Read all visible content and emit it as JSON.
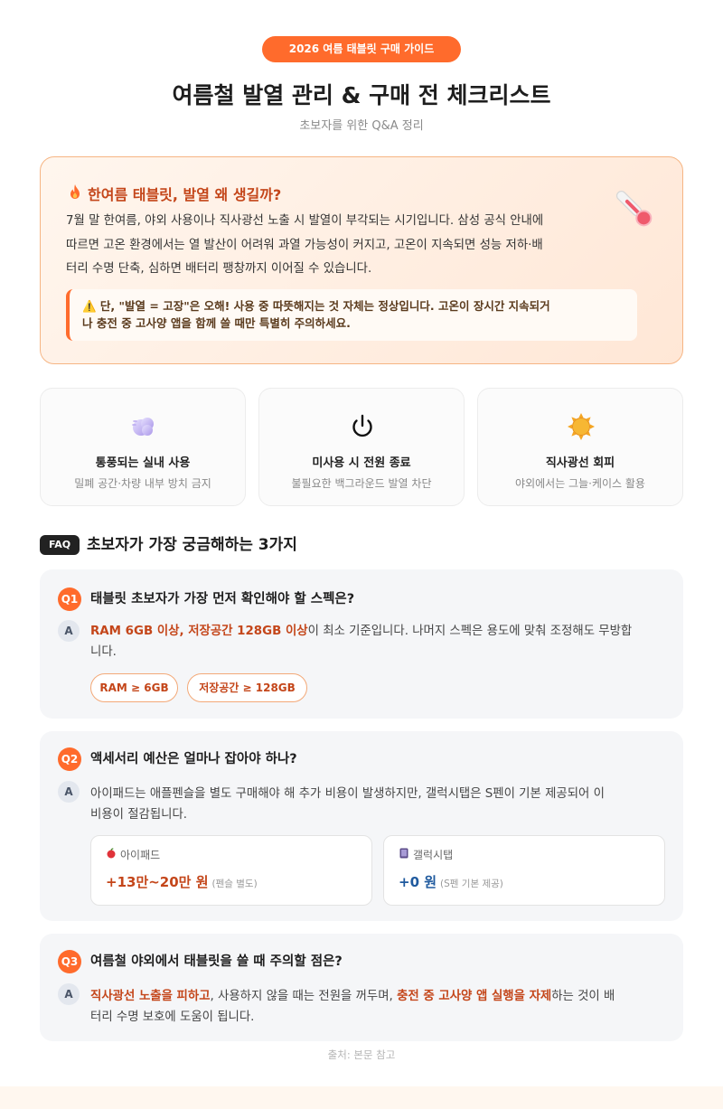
{
  "header": {
    "pill": "2026 여름 태블릿 구매 가이드",
    "title": "여름철 발열 관리 & 구매 전 체크리스트",
    "subtitle": "초보자를 위한 Q&A 정리"
  },
  "hero": {
    "title": "한여름 태블릿, 발열 왜 생길까?",
    "icon": "flame-icon",
    "lines": [
      "7월 말 한여름, 야외 사용이나 직사광선 노출 시 발열이 부각되는 시기입니다. 삼성 공식 안내에",
      "따르면 고온 환경에서는 열 발산이 어려워 과열 가능성이 커지고, 고온이 지속되면 성능 저하·배",
      "터리 수명 단축, 심하면 배터리 팽창까지 이어질 수 있습니다."
    ],
    "note_lines": [
      "⚠️ 단, \"발열 = 고장\"은 오해! 사용 중 따뜻해지는 것 자체는 정상입니다. 고온이 장시간 지속되거",
      "나 충전 중 고사양 앱을 함께 쓸 때만 특별히 주의하세요."
    ]
  },
  "tips": [
    {
      "icon": "wind-cloud-icon",
      "title": "통풍되는 실내 사용",
      "desc": "밀폐 공간·차량 내부 방치 금지"
    },
    {
      "icon": "power-icon",
      "title": "미사용 시 전원 종료",
      "desc": "불필요한 백그라운드 발열 차단"
    },
    {
      "icon": "sun-icon",
      "title": "직사광선 회피",
      "desc": "야외에서는 그늘·케이스 활용"
    }
  ],
  "faq": {
    "tag": "FAQ",
    "title": "초보자가 가장 궁금해하는 3가지",
    "items": [
      {
        "badge": "Q1",
        "question": "태블릿 초보자가 가장 먼저 확인해야 할 스펙은?",
        "a_badge": "A",
        "answer_hl": "RAM 6GB 이상, 저장공간 128GB 이상",
        "answer_rest_1": "이 최소 기준입니다. 나머지 스펙은 용도에 맞춰 조정해도 무방합",
        "answer_rest_2": "니다.",
        "chips": [
          "RAM ≥ 6GB",
          "저장공간 ≥ 128GB"
        ]
      },
      {
        "badge": "Q2",
        "question": "액세서리 예산은 얼마나 잡아야 하나?",
        "a_badge": "A",
        "answer_line_1": "아이패드는 애플펜슬을 별도 구매해야 해 추가 비용이 발생하지만, 갤럭시탭은 S펜이 기본 제공되어 이",
        "answer_line_2": "비용이 절감됩니다.",
        "compare": [
          {
            "icon": "apple-icon",
            "label": "아이패드",
            "value": "+13만~20만 원",
            "note": "(펜슬 별도)",
            "color": "#c4461a"
          },
          {
            "icon": "tablet-icon",
            "label": "갤럭시탭",
            "value": "+0 원",
            "note": "(S펜 기본 제공)",
            "color": "#1f5a9e"
          }
        ]
      },
      {
        "badge": "Q3",
        "question": "여름철 야외에서 태블릿을 쓸 때 주의할 점은?",
        "a_badge": "A",
        "answer_hl_1": "직사광선 노출을 피하고",
        "answer_mid": ", 사용하지 않을 때는 전원을 꺼두며, ",
        "answer_hl_2": "충전 중 고사양 앱 실행을 자제",
        "answer_tail": "하는 것이 배",
        "answer_line_2": "터리 수명 보호에 도움이 됩니다."
      }
    ]
  },
  "source": "출처: 본문 참고",
  "colors": {
    "accent": "#ff6b2c",
    "accent_dark": "#c4461a",
    "blue": "#1f5a9e",
    "card_bg": "#f5f6f8"
  }
}
